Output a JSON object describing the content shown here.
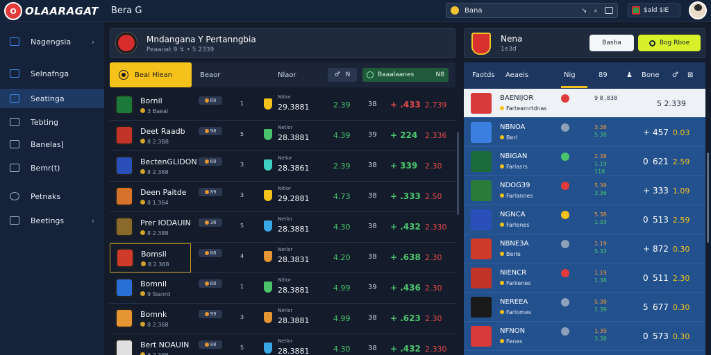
{
  "app": {
    "brand": "OLAARAGAT",
    "brand_initials": "O",
    "top_title": "Bera G"
  },
  "search": {
    "value": "Bana"
  },
  "user": {
    "region": "$ald $iE"
  },
  "sidebar": {
    "items": [
      {
        "label": "Nagengsia",
        "icon": "home-icon",
        "chevron": "›"
      },
      {
        "label": "Selnafnga",
        "icon": "dashboard-icon"
      },
      {
        "label": "Seatinga",
        "icon": "check-icon",
        "active": true
      },
      {
        "label": "Tebting",
        "icon": "house-icon"
      },
      {
        "label": "Banelas]",
        "icon": "grid-icon"
      },
      {
        "label": "Bemr(t)",
        "icon": "tag-icon"
      },
      {
        "label": "Petnaks",
        "icon": "globe-icon"
      },
      {
        "label": "Beetings",
        "icon": "folder-icon",
        "chevron": "›"
      }
    ]
  },
  "match": {
    "title": "Mndangana Y Pertanngbia",
    "subtitle": "Peaaiiat  9  ↯ • 5 2339"
  },
  "tabs": {
    "active": "Beai Hlean",
    "tab2": "Beaor",
    "tab3": "Nlaor",
    "ctl_left": "♂",
    "ctl_right": "N",
    "green_label": "Baaalaanes",
    "green_value": "N8"
  },
  "rows": [
    {
      "name": "Bornil",
      "meta": "3  Baeal",
      "chip": "88",
      "a": "1",
      "label": "Nitlor",
      "val": "29.3881",
      "odd": "2.39",
      "cnt": "38",
      "trend": "+ .433",
      "trend_color": "red",
      "price": "2.739",
      "price_color": "red",
      "crest": "#1b7a3a",
      "shield": "#f4c21a"
    },
    {
      "name": "Deet Raadb",
      "meta": "8  2.3B8",
      "chip": "98",
      "a": "5",
      "label": "Netlor",
      "val": "28.3881",
      "odd": "4.39",
      "cnt": "39",
      "trend": "+ 224",
      "trend_color": "green",
      "price": "2.336",
      "price_color": "red",
      "crest": "#c2332a",
      "shield": "#49c46d"
    },
    {
      "name": "BectenGLIDON",
      "meta": "8  2.368",
      "chip": "68",
      "a": "3",
      "label": "Nelior",
      "val": "28.3861",
      "odd": "2.39",
      "cnt": "38",
      "trend": "+ 339",
      "trend_color": "green",
      "price": "2.30",
      "price_color": "red",
      "crest": "#2a4fb8",
      "shield": "#3fd0c4"
    },
    {
      "name": "Deen Paitde",
      "meta": "8  1.364",
      "chip": "89",
      "a": "3",
      "label": "Nitlor",
      "val": "29.2881",
      "odd": "4.73",
      "cnt": "38",
      "trend": "+ .333",
      "trend_color": "green",
      "price": "2.50",
      "price_color": "red",
      "crest": "#d6722a",
      "shield": "#f4c21a"
    },
    {
      "name": "Prer IODAUIN",
      "meta": "8  2.388",
      "chip": "38",
      "a": "5",
      "label": "Netlor",
      "val": "28.3881",
      "odd": "4.30",
      "cnt": "38",
      "trend": "+ .432",
      "trend_color": "green",
      "price": "2.330",
      "price_color": "red",
      "crest": "#8a6a2a",
      "shield": "#3aa8e6"
    },
    {
      "name": "Bomsil",
      "meta": "8  2.368",
      "chip": "88",
      "a": "4",
      "label": "Netlor",
      "val": "28.3831",
      "odd": "4.20",
      "cnt": "38",
      "trend": "+ .638",
      "trend_color": "green",
      "price": "2.30",
      "price_color": "red",
      "crest": "#d03a2a",
      "shield": "#e69533",
      "highlight": true
    },
    {
      "name": "Bomnil",
      "meta": "9  Sianrd",
      "chip": "88",
      "a": "1",
      "label": "Nitlor",
      "val": "28.3881",
      "odd": "4.99",
      "cnt": "39",
      "trend": "+ .436",
      "trend_color": "green",
      "price": "2.30",
      "price_color": "red",
      "crest": "#2a6fd6",
      "shield": "#49c46d"
    },
    {
      "name": "Bomnk",
      "meta": "8  2.368",
      "chip": "99",
      "a": "3",
      "label": "Netlor",
      "val": "28.3881",
      "odd": "4.99",
      "cnt": "38",
      "trend": "+ .623",
      "trend_color": "green",
      "price": "2.30",
      "price_color": "red",
      "crest": "#e69533",
      "shield": "#e69533"
    },
    {
      "name": "Bert NOAUIN",
      "meta": "8  2.388",
      "chip": "88",
      "a": "5",
      "label": "Netlor",
      "val": "28.3881",
      "odd": "4.30",
      "cnt": "38",
      "trend": "+ .432",
      "trend_color": "green",
      "price": "2.330",
      "price_color": "red",
      "crest": "#e0e0e0",
      "shield": "#3aa8e6"
    }
  ],
  "right": {
    "title": "Nena",
    "subtitle": "1e3d",
    "btn_white": "Basha",
    "btn_yellow": "Bog Rboe",
    "head": {
      "c1": "Faotds",
      "c2": "Aeaeis",
      "c3": "Nig",
      "c4": "89",
      "c5": "Bone",
      "c6": "♂",
      "c7": "⊠"
    },
    "rows": [
      {
        "name": "BAENIJOR",
        "team": "Farteamrtdnas",
        "mid1": "9 8 .838",
        "mid2": "",
        "mid3": "",
        "pre": "",
        "val": "",
        "chg": "5 2.339",
        "jersey": "#d63a3a",
        "badge": "#e23b3b",
        "first": true
      },
      {
        "name": "NBNOA",
        "team": "Berl",
        "mid1": "3.38",
        "mid2": "5.38",
        "mid3": "",
        "pre": "+",
        "val": "457",
        "chg": "0.03",
        "jersey": "#3b7fe0",
        "badge": "#8fa0ba"
      },
      {
        "name": "NBIGAN",
        "team": "Farlasrs",
        "mid1": "2.38",
        "mid2": "1.19",
        "mid3": "118",
        "pre": "0",
        "val": "621",
        "chg": "2.59",
        "jersey": "#1b6a3a",
        "badge": "#49c46d"
      },
      {
        "name": "NDOG39",
        "team": "Farlannes",
        "mid1": "5.39",
        "mid2": "3.36",
        "mid3": "",
        "pre": "+",
        "val": "333",
        "chg": "1.09",
        "jersey": "#2a7a3a",
        "badge": "#e23b3b"
      },
      {
        "name": "NGNCA",
        "team": "Farlenes",
        "mid1": "5.38",
        "mid2": "1.33",
        "mid3": "",
        "pre": "0",
        "val": "513",
        "chg": "2.59",
        "jersey": "#2a4fb8",
        "badge": "#f4c21a"
      },
      {
        "name": "NBNE3A",
        "team": "Berle",
        "mid1": "1.19",
        "mid2": "5.33",
        "mid3": "",
        "pre": "+",
        "val": "872",
        "chg": "0.30",
        "jersey": "#d03a2a",
        "badge": "#8fa0ba"
      },
      {
        "name": "NIENCR",
        "team": "Farkenes",
        "mid1": "1.19",
        "mid2": "1.38",
        "mid3": "",
        "pre": "0",
        "val": "511",
        "chg": "2.30",
        "jersey": "#c2332a",
        "badge": "#e23b3b"
      },
      {
        "name": "NEREEA",
        "team": "Farlomes",
        "mid1": "5.38",
        "mid2": "1.39",
        "mid3": "",
        "pre": "5",
        "val": "677",
        "chg": "0.30",
        "jersey": "#1a1a1a",
        "badge": "#8fa0ba"
      },
      {
        "name": "NFNON",
        "team": "Fenes",
        "mid1": "1.39",
        "mid2": "3.38",
        "mid3": "",
        "pre": "0",
        "val": "573",
        "chg": "0.30",
        "jersey": "#d63a3a",
        "badge": "#8fa0ba"
      }
    ]
  }
}
